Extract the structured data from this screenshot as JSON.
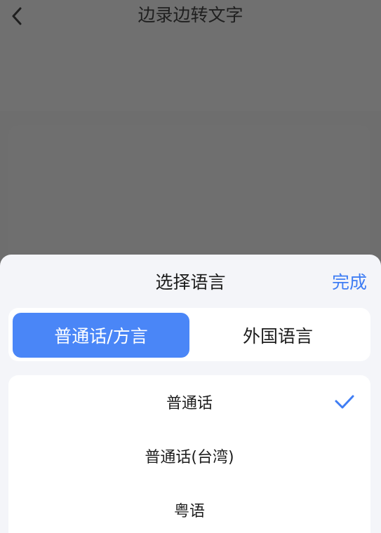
{
  "header": {
    "title": "边录边转文字"
  },
  "sheet": {
    "title": "选择语言",
    "done_label": "完成",
    "tabs": [
      {
        "label": "普通话/方言",
        "active": true
      },
      {
        "label": "外国语言",
        "active": false
      }
    ],
    "languages": [
      {
        "label": "普通话",
        "selected": true
      },
      {
        "label": "普通话(台湾)",
        "selected": false
      },
      {
        "label": "粤语",
        "selected": false
      }
    ]
  },
  "colors": {
    "accent": "#4a86f7",
    "done_text": "#3f7df4",
    "sheet_bg": "#f4f5f9",
    "overlay": "#6e6e6e"
  },
  "icons": {
    "back": "chevron-left-icon",
    "selected": "checkmark-icon"
  }
}
